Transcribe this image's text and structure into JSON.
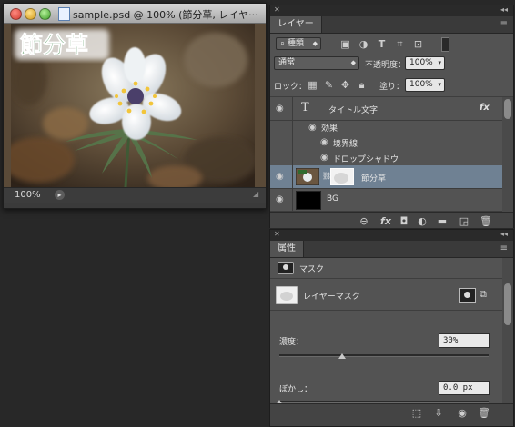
{
  "document": {
    "title": "sample.psd @ 100% (節分草, レイヤ···",
    "overlay_text": "節分草",
    "zoom": "100%",
    "overlay_color": "#0f6a1c"
  },
  "layers_panel": {
    "tab": "レイヤー",
    "filter_kind": "種類",
    "blend_mode": "通常",
    "opacity_label": "不透明度：",
    "opacity_value": "100%",
    "lock_label": "ロック：",
    "fill_label": "塗り：",
    "fill_value": "100%",
    "layers": [
      {
        "name": "タイトル文字",
        "kind": "text",
        "fx": "fx",
        "effects_label": "効果",
        "effects": [
          "境界線",
          "ドロップシャドウ"
        ]
      },
      {
        "name": "節分草",
        "kind": "image-with-mask",
        "selected": true
      },
      {
        "name": "BG",
        "kind": "fill"
      }
    ]
  },
  "properties_panel": {
    "tab": "属性",
    "type_label": "マスク",
    "mask_name": "レイヤーマスク",
    "density_label": "濃度：",
    "density_value": "30%",
    "density_fraction": 0.3,
    "feather_label": "ぼかし：",
    "feather_value": "0.0 px"
  },
  "colors": {
    "selected_row": "#6f8193",
    "panel": "#535353",
    "workspace": "#282828"
  }
}
